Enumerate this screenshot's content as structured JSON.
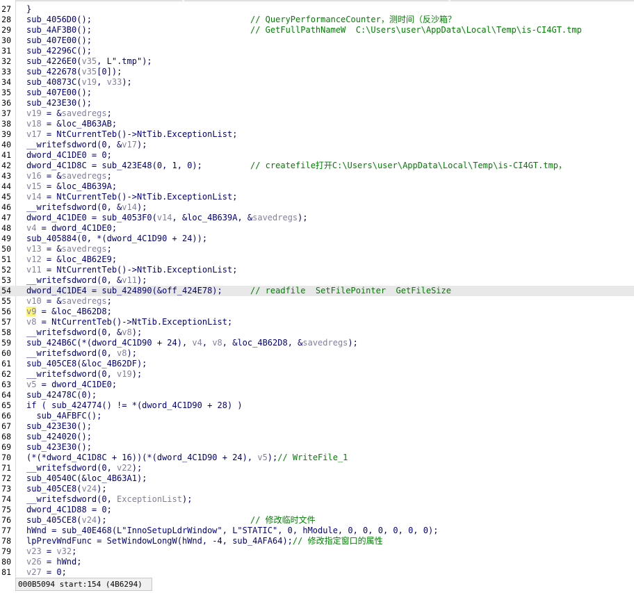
{
  "window": {
    "status_text": "000B5094 start:154 (4B6294)"
  },
  "editor": {
    "current_line": "54",
    "lines": [
      {
        "n": "27",
        "t": [
          [
            "n",
            "}"
          ]
        ]
      },
      {
        "n": "28",
        "t": [
          [
            "n",
            "sub_4056D0();"
          ]
        ],
        "c": "// QueryPerformanceCounter，测时间（反沙箱？"
      },
      {
        "n": "29",
        "t": [
          [
            "n",
            "sub_4AF3B0();"
          ]
        ],
        "c": "// GetFullPathNameW  C:\\Users\\user\\AppData\\Local\\Temp\\is-CI4GT.tmp"
      },
      {
        "n": "30",
        "t": [
          [
            "n",
            "sub_407E00();"
          ]
        ]
      },
      {
        "n": "31",
        "t": [
          [
            "n",
            "sub_42296C();"
          ]
        ]
      },
      {
        "n": "32",
        "t": [
          [
            "n",
            "sub_4226E0("
          ],
          [
            "v",
            "v35"
          ],
          [
            "n",
            ", L\".tmp\");"
          ]
        ]
      },
      {
        "n": "33",
        "t": [
          [
            "n",
            "sub_422678("
          ],
          [
            "v",
            "v35"
          ],
          [
            "n",
            "[0]);"
          ]
        ]
      },
      {
        "n": "34",
        "t": [
          [
            "n",
            "sub_40873C("
          ],
          [
            "v",
            "v19"
          ],
          [
            "n",
            ", "
          ],
          [
            "v",
            "v33"
          ],
          [
            "n",
            ");"
          ]
        ]
      },
      {
        "n": "35",
        "t": [
          [
            "n",
            "sub_407E00();"
          ]
        ]
      },
      {
        "n": "36",
        "t": [
          [
            "n",
            "sub_423E30();"
          ]
        ]
      },
      {
        "n": "37",
        "t": [
          [
            "v",
            "v19"
          ],
          [
            "n",
            " = &"
          ],
          [
            "v",
            "savedregs"
          ],
          [
            "n",
            ";"
          ]
        ]
      },
      {
        "n": "38",
        "t": [
          [
            "v",
            "v18"
          ],
          [
            "n",
            " = &loc_4B63AB;"
          ]
        ]
      },
      {
        "n": "39",
        "t": [
          [
            "v",
            "v17"
          ],
          [
            "n",
            " = NtCurrentTeb()->NtTib.ExceptionList;"
          ]
        ]
      },
      {
        "n": "40",
        "t": [
          [
            "n",
            "__writefsdword(0, &"
          ],
          [
            "v",
            "v17"
          ],
          [
            "n",
            ");"
          ]
        ]
      },
      {
        "n": "41",
        "t": [
          [
            "n",
            "dword_4C1DE0 = 0;"
          ]
        ]
      },
      {
        "n": "42",
        "t": [
          [
            "n",
            "dword_4C1D8C = sub_423E48(0, 1, 0);"
          ]
        ],
        "c": "// createfile打开C:\\Users\\user\\AppData\\Local\\Temp\\is-CI4GT.tmp，"
      },
      {
        "n": "43",
        "t": [
          [
            "v",
            "v16"
          ],
          [
            "n",
            " = &"
          ],
          [
            "v",
            "savedregs"
          ],
          [
            "n",
            ";"
          ]
        ]
      },
      {
        "n": "44",
        "t": [
          [
            "v",
            "v15"
          ],
          [
            "n",
            " = &loc_4B639A;"
          ]
        ]
      },
      {
        "n": "45",
        "t": [
          [
            "v",
            "v14"
          ],
          [
            "n",
            " = NtCurrentTeb()->NtTib.ExceptionList;"
          ]
        ]
      },
      {
        "n": "46",
        "t": [
          [
            "n",
            "__writefsdword(0, &"
          ],
          [
            "v",
            "v14"
          ],
          [
            "n",
            ");"
          ]
        ]
      },
      {
        "n": "47",
        "t": [
          [
            "n",
            "dword_4C1DE0 = sub_4053F0("
          ],
          [
            "v",
            "v14"
          ],
          [
            "n",
            ", &loc_4B639A, &"
          ],
          [
            "v",
            "savedregs"
          ],
          [
            "n",
            ");"
          ]
        ]
      },
      {
        "n": "48",
        "t": [
          [
            "v",
            "v4"
          ],
          [
            "n",
            " = dword_4C1DE0;"
          ]
        ]
      },
      {
        "n": "49",
        "t": [
          [
            "n",
            "sub_405884(0, *(dword_4C1D90 + 24));"
          ]
        ]
      },
      {
        "n": "50",
        "t": [
          [
            "v",
            "v13"
          ],
          [
            "n",
            " = &"
          ],
          [
            "v",
            "savedregs"
          ],
          [
            "n",
            ";"
          ]
        ]
      },
      {
        "n": "51",
        "t": [
          [
            "v",
            "v12"
          ],
          [
            "n",
            " = &loc_4B62E9;"
          ]
        ]
      },
      {
        "n": "52",
        "t": [
          [
            "v",
            "v11"
          ],
          [
            "n",
            " = NtCurrentTeb()->NtTib.ExceptionList;"
          ]
        ]
      },
      {
        "n": "53",
        "t": [
          [
            "n",
            "__writefsdword(0, &"
          ],
          [
            "v",
            "v11"
          ],
          [
            "n",
            ");"
          ]
        ]
      },
      {
        "n": "54",
        "t": [
          [
            "n",
            "dword_4C1DE4 = sub_424890(&off_424E78);"
          ]
        ],
        "c": "// readfile  SetFilePointer  GetFileSize"
      },
      {
        "n": "55",
        "t": [
          [
            "v",
            "v10"
          ],
          [
            "n",
            " = &"
          ],
          [
            "v",
            "savedregs"
          ],
          [
            "n",
            ";"
          ]
        ]
      },
      {
        "n": "56",
        "t": [
          [
            "h",
            "v9"
          ],
          [
            "n",
            " = &loc_4B62D8;"
          ]
        ]
      },
      {
        "n": "57",
        "t": [
          [
            "v",
            "v8"
          ],
          [
            "n",
            " = NtCurrentTeb()->NtTib.ExceptionList;"
          ]
        ]
      },
      {
        "n": "58",
        "t": [
          [
            "n",
            "__writefsdword(0, &"
          ],
          [
            "v",
            "v8"
          ],
          [
            "n",
            ");"
          ]
        ]
      },
      {
        "n": "59",
        "t": [
          [
            "n",
            "sub_424B6C(*(dword_4C1D90 + 24), "
          ],
          [
            "v",
            "v4"
          ],
          [
            "n",
            ", "
          ],
          [
            "v",
            "v8"
          ],
          [
            "n",
            ", &loc_4B62D8, &"
          ],
          [
            "v",
            "savedregs"
          ],
          [
            "n",
            ");"
          ]
        ]
      },
      {
        "n": "60",
        "t": [
          [
            "n",
            "__writefsdword(0, "
          ],
          [
            "v",
            "v8"
          ],
          [
            "n",
            ");"
          ]
        ]
      },
      {
        "n": "61",
        "t": [
          [
            "n",
            "sub_405CE8(&loc_4B62DF);"
          ]
        ]
      },
      {
        "n": "62",
        "t": [
          [
            "n",
            "__writefsdword(0, "
          ],
          [
            "v",
            "v19"
          ],
          [
            "n",
            ");"
          ]
        ]
      },
      {
        "n": "63",
        "t": [
          [
            "v",
            "v5"
          ],
          [
            "n",
            " = dword_4C1DE0;"
          ]
        ]
      },
      {
        "n": "64",
        "t": [
          [
            "n",
            "sub_42478C(0);"
          ]
        ]
      },
      {
        "n": "65",
        "t": [
          [
            "n",
            "if ( sub_424774() != *(dword_4C1D90 + 28) )"
          ]
        ]
      },
      {
        "n": "66",
        "t": [
          [
            "n",
            "  sub_4AFBFC();"
          ]
        ]
      },
      {
        "n": "67",
        "t": [
          [
            "n",
            "sub_423E30();"
          ]
        ]
      },
      {
        "n": "68",
        "t": [
          [
            "n",
            "sub_424020();"
          ]
        ]
      },
      {
        "n": "69",
        "t": [
          [
            "n",
            "sub_423E30();"
          ]
        ]
      },
      {
        "n": "70",
        "t": [
          [
            "n",
            "(*(*dword_4C1D8C + 16))(*(dword_4C1D90 + 24), "
          ],
          [
            "v",
            "v5"
          ],
          [
            "n",
            ");"
          ],
          [
            "c",
            "// WriteFile_1"
          ]
        ]
      },
      {
        "n": "71",
        "t": [
          [
            "n",
            "__writefsdword(0, "
          ],
          [
            "v",
            "v22"
          ],
          [
            "n",
            ");"
          ]
        ]
      },
      {
        "n": "72",
        "t": [
          [
            "n",
            "sub_40540C(&loc_4B63A1);"
          ]
        ]
      },
      {
        "n": "73",
        "t": [
          [
            "n",
            "sub_405CE8("
          ],
          [
            "v",
            "v24"
          ],
          [
            "n",
            ");"
          ]
        ]
      },
      {
        "n": "74",
        "t": [
          [
            "n",
            "__writefsdword(0, "
          ],
          [
            "v",
            "ExceptionList"
          ],
          [
            "n",
            ");"
          ]
        ]
      },
      {
        "n": "75",
        "t": [
          [
            "n",
            "dword_4C1D88 = 0;"
          ]
        ]
      },
      {
        "n": "76",
        "t": [
          [
            "n",
            "sub_405CE8("
          ],
          [
            "v",
            "v24"
          ],
          [
            "n",
            ");"
          ]
        ],
        "c": "// 修改临时文件"
      },
      {
        "n": "77",
        "t": [
          [
            "n",
            "hWnd = sub_40E468(L\"InnoSetupLdrWindow\", L\"STATIC\", 0, hModule, 0, 0, 0, 0, 0, 0);"
          ]
        ]
      },
      {
        "n": "78",
        "t": [
          [
            "n",
            "lpPrevWndFunc = SetWindowLongW(hWnd, -4, sub_4AFA64);"
          ],
          [
            "c",
            "// 修改指定窗口的属性"
          ]
        ]
      },
      {
        "n": "79",
        "t": [
          [
            "v",
            "v23"
          ],
          [
            "n",
            " = "
          ],
          [
            "v",
            "v32"
          ],
          [
            "n",
            ";"
          ]
        ]
      },
      {
        "n": "80",
        "t": [
          [
            "v",
            "v26"
          ],
          [
            "n",
            " = hWnd;"
          ]
        ]
      },
      {
        "n": "81",
        "t": [
          [
            "v",
            "v27"
          ],
          [
            "n",
            " = 0;"
          ]
        ]
      }
    ]
  }
}
